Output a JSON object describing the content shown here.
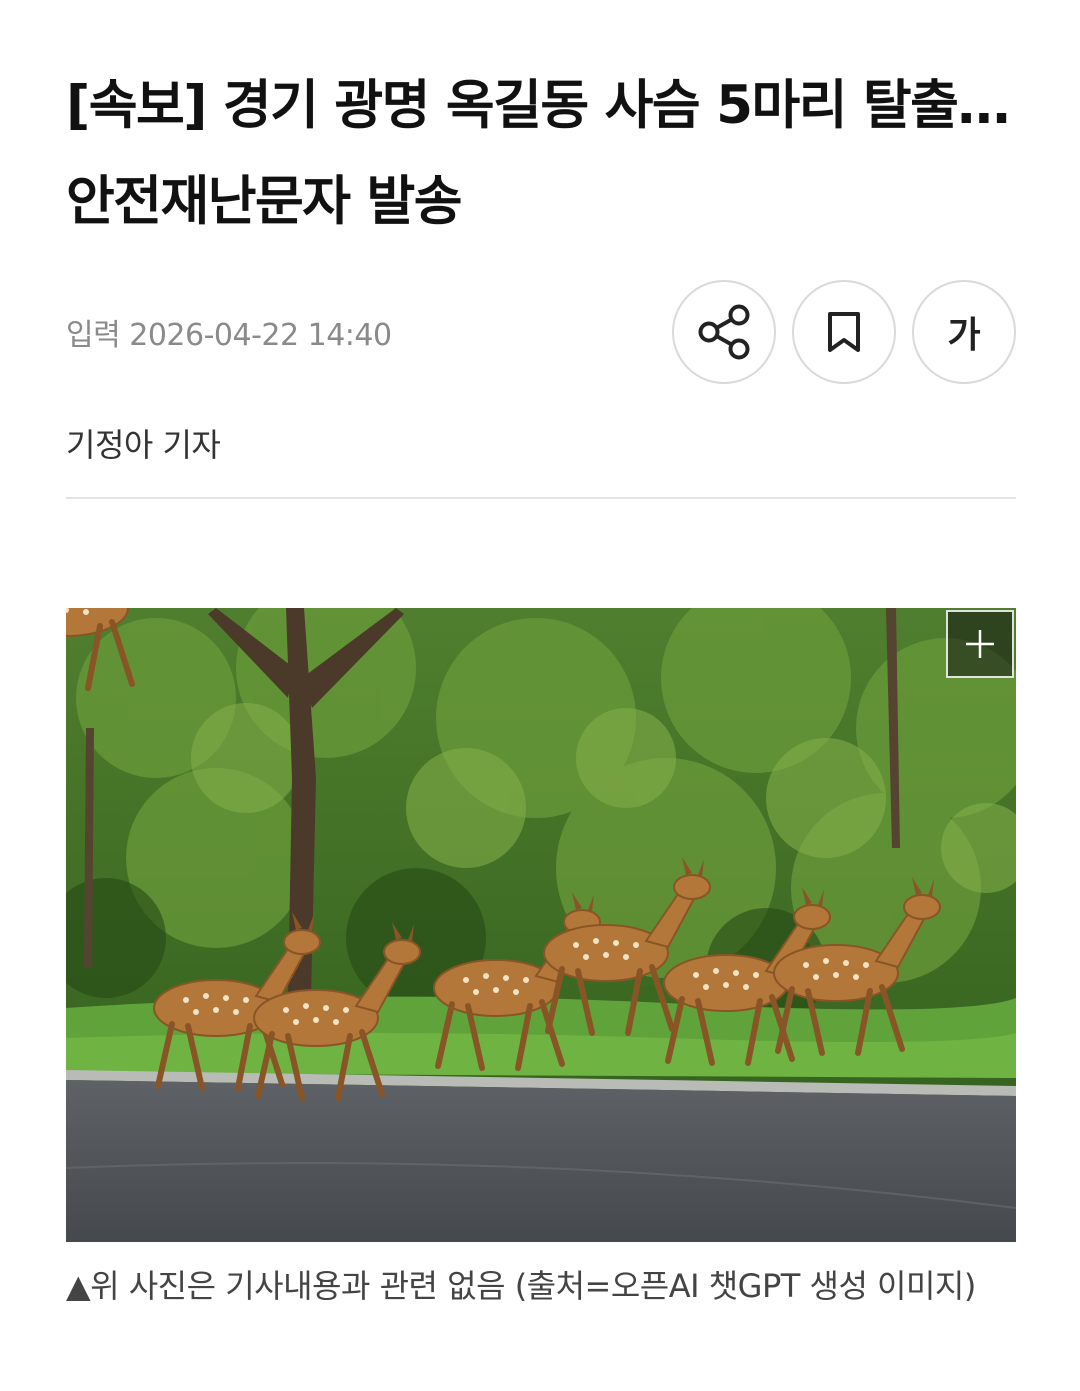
{
  "article": {
    "headline": "[속보] 경기 광명 옥길동 사슴 5마리 탈출…안전재난문자 발송",
    "published_label": "입력 2026-04-22 14:40",
    "byline": "기정아 기자",
    "font_size_button_label": "가",
    "caption": "▲위 사진은 기사내용과 관련 없음 (출처=오픈AI 챗GPT 생성 이미지)"
  },
  "toolbar": {
    "icons": [
      "share-icon",
      "bookmark-icon",
      "font-size-icon"
    ]
  },
  "photo": {
    "icons": [
      "expand-icon"
    ]
  },
  "colors": {
    "text": "#111111",
    "meta": "#8a8a8a",
    "border": "#d9d9d9",
    "divider": "#e3e3e3"
  }
}
